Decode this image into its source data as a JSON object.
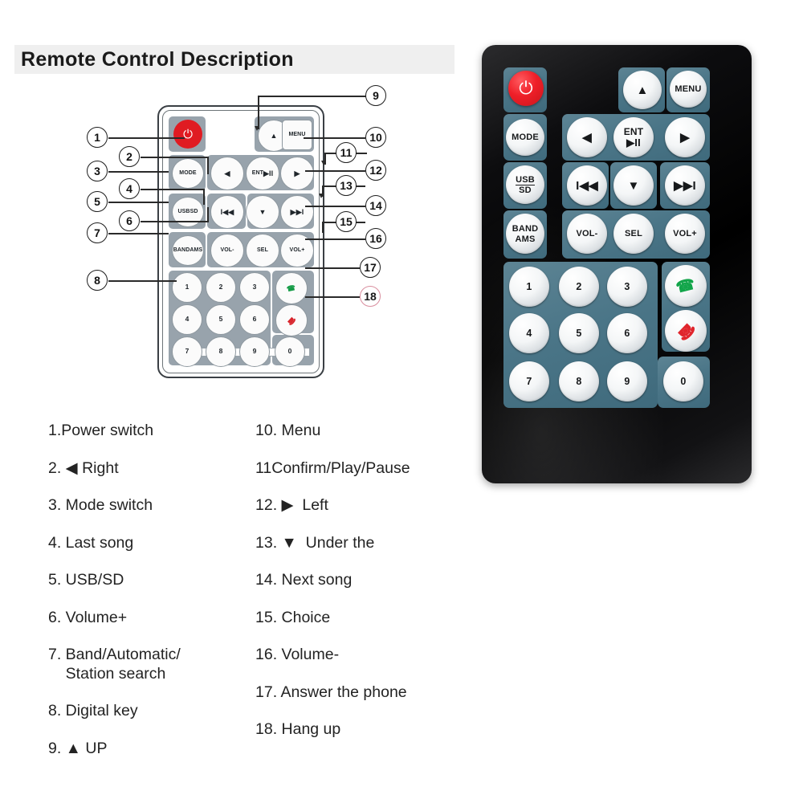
{
  "header": {
    "title": "Remote Control Description"
  },
  "diagram": {
    "name": "remote-line-drawing",
    "power_icon": "power-icon",
    "buttons": [
      {
        "key": "power",
        "label": ""
      },
      {
        "key": "up",
        "label": "▲"
      },
      {
        "key": "menu",
        "label": "MENU"
      },
      {
        "key": "mode",
        "label": "MODE"
      },
      {
        "key": "left",
        "label": "◀"
      },
      {
        "key": "ent",
        "label": "ENT",
        "sub": "▶II"
      },
      {
        "key": "right",
        "label": "▶"
      },
      {
        "key": "usbsd",
        "label": "USB",
        "sub": "SD"
      },
      {
        "key": "prev",
        "label": "I◀◀"
      },
      {
        "key": "down",
        "label": "▼"
      },
      {
        "key": "next",
        "label": "▶▶I"
      },
      {
        "key": "bandams",
        "label": "BAND",
        "sub": "AMS"
      },
      {
        "key": "volminus",
        "label": "VOL-"
      },
      {
        "key": "sel",
        "label": "SEL"
      },
      {
        "key": "volplus",
        "label": "VOL+"
      },
      {
        "key": "answer",
        "label": "✆"
      },
      {
        "key": "hangup",
        "label": "✆"
      }
    ],
    "keypad": [
      "1",
      "2",
      "3",
      "4",
      "5",
      "6",
      "7",
      "8",
      "9",
      "0"
    ],
    "callouts": [
      {
        "n": "1"
      },
      {
        "n": "2"
      },
      {
        "n": "3"
      },
      {
        "n": "4"
      },
      {
        "n": "5"
      },
      {
        "n": "6"
      },
      {
        "n": "7"
      },
      {
        "n": "8"
      },
      {
        "n": "9"
      },
      {
        "n": "10"
      },
      {
        "n": "11"
      },
      {
        "n": "12"
      },
      {
        "n": "13"
      },
      {
        "n": "14"
      },
      {
        "n": "15"
      },
      {
        "n": "16"
      },
      {
        "n": "17"
      },
      {
        "n": "18"
      }
    ],
    "callout_18_color": "#d98e9e"
  },
  "photo": {
    "name": "remote-photo",
    "body_color": "#000000",
    "panel_color": "#4a7587",
    "power_color": "#ef1f28",
    "answer_color": "#12a54a",
    "hangup_color": "#e0252c",
    "buttons": {
      "menu": "MENU",
      "mode": "MODE",
      "ent": "ENT",
      "ent_sub": "▶II",
      "usb": "USB",
      "sd": "SD",
      "band": "BAND",
      "ams": "AMS",
      "vol_minus": "VOL-",
      "sel": "SEL",
      "vol_plus": "VOL+",
      "up": "▲",
      "down": "▼",
      "left": "◀",
      "right": "▶",
      "prev": "I◀◀",
      "next": "▶▶I",
      "answer": "✆",
      "hangup": "✆"
    },
    "keypad": [
      "1",
      "2",
      "3",
      "4",
      "5",
      "6",
      "7",
      "8",
      "9",
      "0"
    ]
  },
  "legend": {
    "left": [
      "1.Power switch",
      "2. ◀ Right",
      "3. Mode switch",
      "4. Last song",
      "5. USB/SD",
      "6. Volume+",
      "7. Band/Automatic/\n    Station search",
      "8. Digital key",
      "9. ▲ UP"
    ],
    "right": [
      "10. Menu",
      "11Confirm/Play/Pause",
      "12. ▶  Left",
      "13. ▼  Under the",
      "14. Next song",
      "15. Choice",
      "16. Volume-",
      "17. Answer the phone",
      "18. Hang up"
    ]
  }
}
